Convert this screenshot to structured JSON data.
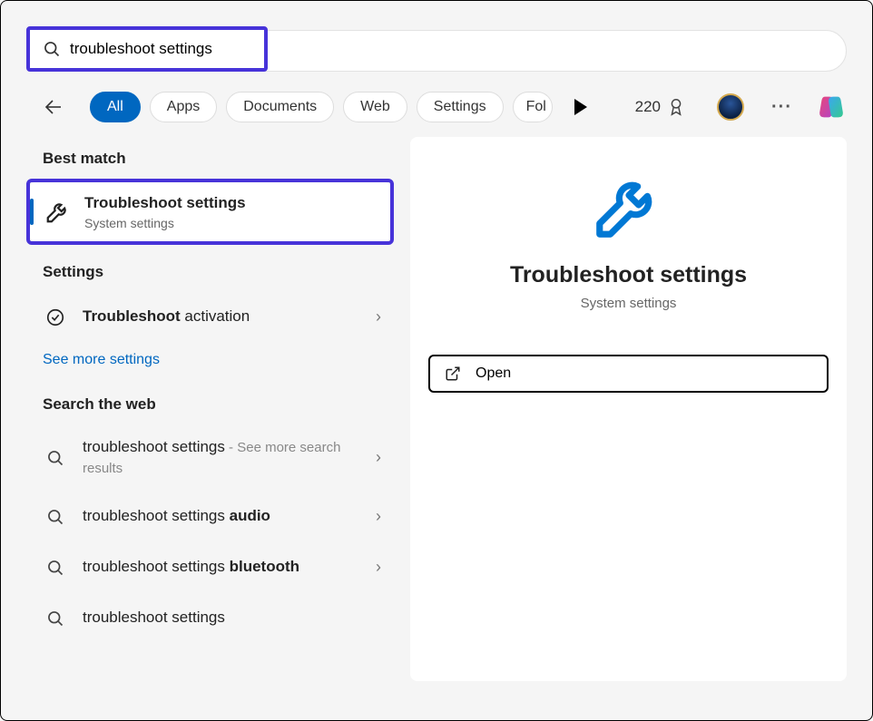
{
  "search": {
    "query": "troubleshoot settings"
  },
  "filters": {
    "items": [
      "All",
      "Apps",
      "Documents",
      "Web",
      "Settings",
      "Fol"
    ],
    "active_index": 0
  },
  "header": {
    "points": "220"
  },
  "results": {
    "best_match_label": "Best match",
    "best_match": {
      "title": "Troubleshoot settings",
      "subtitle": "System settings"
    },
    "settings_label": "Settings",
    "settings_items": [
      {
        "prefix_bold": "Troubleshoot",
        "suffix": " activation"
      }
    ],
    "see_more": "See more settings",
    "web_label": "Search the web",
    "web_items": [
      {
        "main": "troubleshoot settings",
        "bold": "",
        "extra": " - See more search results"
      },
      {
        "main": "troubleshoot settings ",
        "bold": "audio",
        "extra": ""
      },
      {
        "main": "troubleshoot settings ",
        "bold": "bluetooth",
        "extra": ""
      },
      {
        "main": "troubleshoot settings",
        "bold": "",
        "extra": ""
      }
    ]
  },
  "preview": {
    "title": "Troubleshoot settings",
    "subtitle": "System settings",
    "open_label": "Open"
  }
}
